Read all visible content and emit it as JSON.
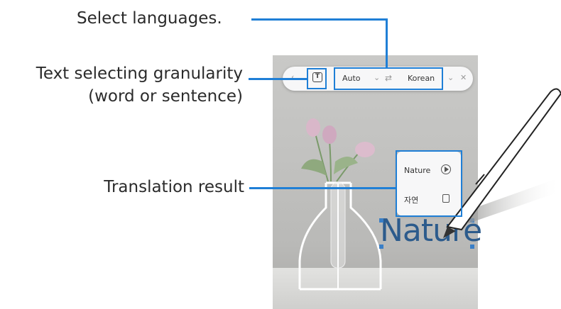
{
  "callouts": {
    "select_languages": "Select languages.",
    "granularity_line1": "Text selecting granularity",
    "granularity_line2": "(word or sentence)",
    "translation_result": "Translation result"
  },
  "toolbar": {
    "granularity_icon": "text-box-icon",
    "source_language": "Auto",
    "target_language": "Korean",
    "swap_icon": "swap-arrows-icon",
    "close_icon": "close-icon"
  },
  "result": {
    "source_word": "Nature",
    "translated_word": "자연",
    "play_icon": "play-icon",
    "copy_icon": "copy-icon"
  },
  "canvas": {
    "selected_word": "Nature"
  },
  "colors": {
    "callout_accent": "#1f7fd6"
  }
}
